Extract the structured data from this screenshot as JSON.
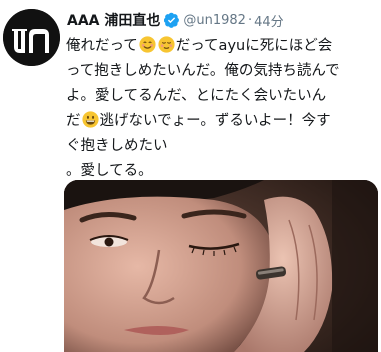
{
  "tweet": {
    "display_name": "AAA 浦田直也",
    "handle": "@un1982",
    "separator": "·",
    "time": "44分",
    "lines": [
      {
        "a": "俺れだって",
        "b": "だってayuに死にほど会"
      },
      {
        "a": "って抱きしめたいんだ。俺の気持ち読んで"
      },
      {
        "a": "よ。愛してるんだ、とにたく会いたいん"
      },
      {
        "a": "だ",
        "b": "逃げないでょー。ずるいよー！今す"
      },
      {
        "a": "ぐ抱きしめたい"
      },
      {
        "a": "。愛してる。"
      }
    ]
  },
  "icons": {
    "avatar": "un-logo-avatar",
    "verified": "verified-badge-icon",
    "emoji_1": "smiling-face-icon",
    "emoji_2": "relieved-face-icon",
    "emoji_3": "grinning-face-icon"
  },
  "colors": {
    "verified": "#1da1f2",
    "secondary_text": "#657786",
    "emoji": "#f7c531"
  },
  "media": {
    "type": "photo",
    "subject": "selfie"
  }
}
